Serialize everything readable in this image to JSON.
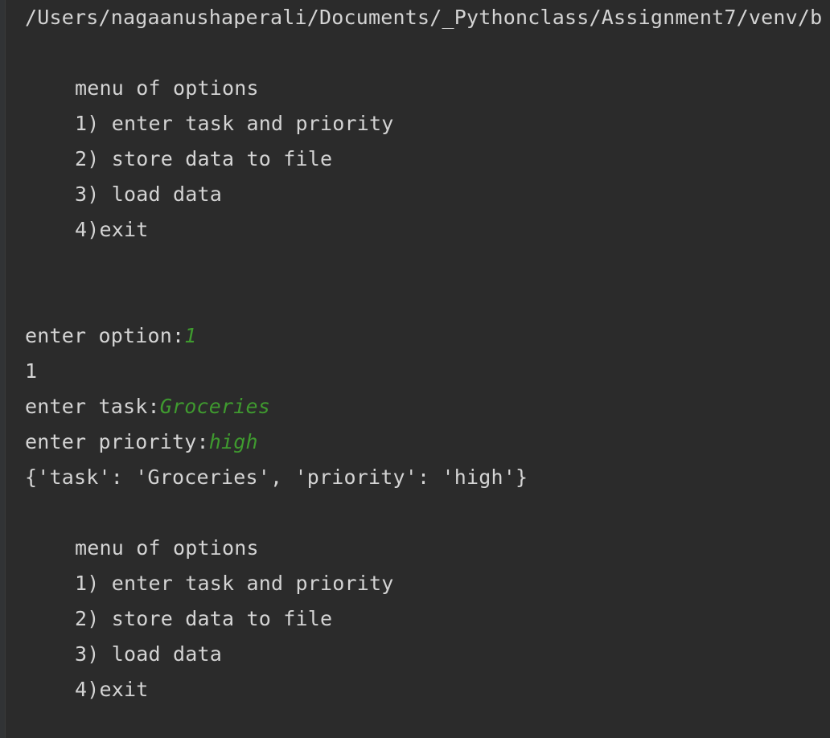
{
  "console": {
    "path": "/Users/nagaanushaperali/Documents/_Pythonclass/Assignment7/venv/b",
    "menu1": {
      "title": "menu of options",
      "opt1": "1) enter task and priority",
      "opt2": "2) store data to file",
      "opt3": "3) load data",
      "opt4": "4)exit"
    },
    "option_prompt": "enter option:",
    "option_input": "1",
    "echo": "1",
    "task_prompt": "enter task:",
    "task_input": "Groceries",
    "priority_prompt": "enter priority:",
    "priority_input": "high",
    "dict_output": "{'task': 'Groceries', 'priority': 'high'}",
    "menu2": {
      "title": "menu of options",
      "opt1": "1) enter task and priority",
      "opt2": "2) store data to file",
      "opt3": "3) load data",
      "opt4": "4)exit"
    }
  },
  "colors": {
    "background": "#2b2b2b",
    "text": "#d4d4d4",
    "user_input": "#3f9a2f"
  }
}
